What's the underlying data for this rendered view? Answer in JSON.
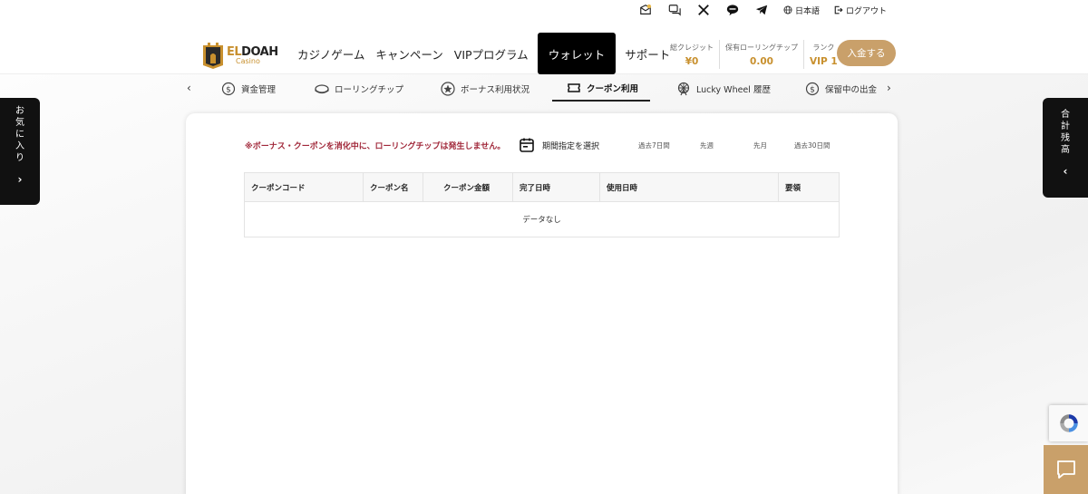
{
  "topbar": {
    "language": "日本語",
    "logout": "ログアウト"
  },
  "logo": {
    "line1_a": "EL",
    "line1_b": "DOAH",
    "line2": "Casino"
  },
  "nav": [
    {
      "label": "カジノゲーム"
    },
    {
      "label": "キャンペーン"
    },
    {
      "label": "VIPプログラム"
    },
    {
      "label": "ウォレット",
      "active": true
    },
    {
      "label": "サポート"
    }
  ],
  "stats": [
    {
      "label": "総クレジット",
      "value": "¥0"
    },
    {
      "label": "保有ローリングチップ",
      "value": "0.00"
    },
    {
      "label": "ランク",
      "value": "VIP 1"
    }
  ],
  "deposit_label": "入金する",
  "subtabs": [
    {
      "label": "資金管理"
    },
    {
      "label": "ローリングチップ"
    },
    {
      "label": "ボーナス利用状況"
    },
    {
      "label": "クーポン利用",
      "active": true
    },
    {
      "label": "Lucky Wheel 履歴"
    },
    {
      "label": "保留中の出金"
    }
  ],
  "side_left": {
    "label": "お気に入り",
    "chevron": "›"
  },
  "side_right": {
    "label": "合計残高",
    "chevron": "‹"
  },
  "panel": {
    "notice": "※ボーナス・クーポンを消化中に、ローリングチップは発生しません。",
    "period_button": "期間指定を選択",
    "quick_filters": [
      "過去7日間",
      "先週",
      "先月",
      "過去30日間"
    ],
    "columns": [
      "クーポンコード",
      "クーポン名",
      "クーポン金額",
      "完了日時",
      "使用日時",
      "要領"
    ],
    "empty_text": "データなし"
  },
  "colors": {
    "accent_gold": "#c9a06a",
    "notice_red": "#a1283a",
    "dark": "#111111"
  }
}
